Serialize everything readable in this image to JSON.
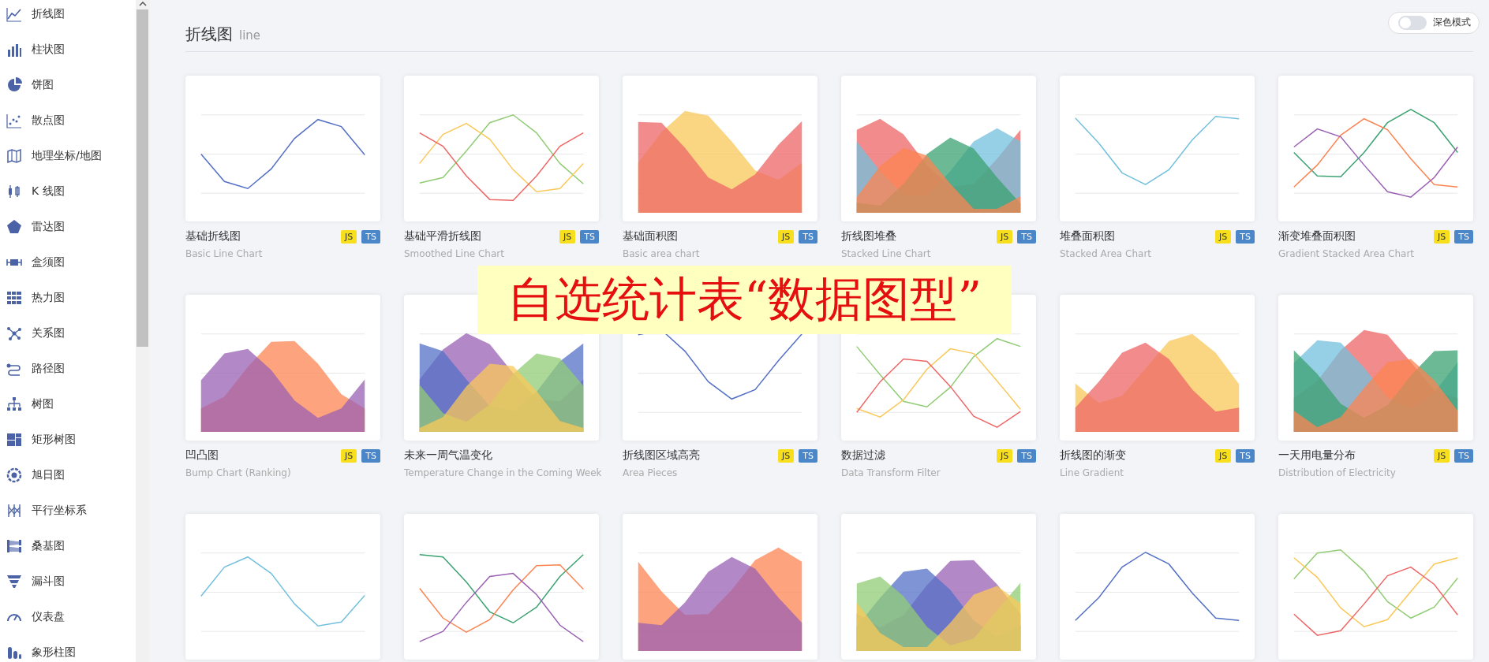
{
  "sidebar": {
    "items": [
      {
        "label": "折线图"
      },
      {
        "label": "柱状图"
      },
      {
        "label": "饼图"
      },
      {
        "label": "散点图"
      },
      {
        "label": "地理坐标/地图"
      },
      {
        "label": "K 线图"
      },
      {
        "label": "雷达图"
      },
      {
        "label": "盒须图"
      },
      {
        "label": "热力图"
      },
      {
        "label": "关系图"
      },
      {
        "label": "路径图"
      },
      {
        "label": "树图"
      },
      {
        "label": "矩形树图"
      },
      {
        "label": "旭日图"
      },
      {
        "label": "平行坐标系"
      },
      {
        "label": "桑基图"
      },
      {
        "label": "漏斗图"
      },
      {
        "label": "仪表盘"
      },
      {
        "label": "象形柱图"
      }
    ]
  },
  "header": {
    "title": "折线图",
    "subtitle": "line"
  },
  "dark_mode": {
    "label": "深色模式",
    "on": false
  },
  "cards": [
    {
      "thumbnail": {
        "kind": "picture"
      },
      "title": "基础折线图",
      "subtitle": "Basic Line Chart",
      "badges": [
        {
          "label": "JS",
          "kind": "js"
        },
        {
          "label": "TS",
          "kind": "ts"
        }
      ]
    },
    {
      "thumbnail": {
        "kind": "picture"
      },
      "title": "基础平滑折线图",
      "subtitle": "Smoothed Line Chart",
      "badges": [
        {
          "label": "JS",
          "kind": "js"
        },
        {
          "label": "TS",
          "kind": "ts"
        }
      ]
    },
    {
      "thumbnail": {
        "kind": "picture"
      },
      "title": "基础面积图",
      "subtitle": "Basic area chart",
      "badges": [
        {
          "label": "JS",
          "kind": "js"
        },
        {
          "label": "TS",
          "kind": "ts"
        }
      ]
    },
    {
      "thumbnail": {
        "kind": "picture"
      },
      "title": "折线图堆叠",
      "subtitle": "Stacked Line Chart",
      "badges": [
        {
          "label": "JS",
          "kind": "js"
        },
        {
          "label": "TS",
          "kind": "ts"
        }
      ]
    },
    {
      "thumbnail": {
        "kind": "picture"
      },
      "title": "堆叠面积图",
      "subtitle": "Stacked Area Chart",
      "badges": [
        {
          "label": "JS",
          "kind": "js"
        },
        {
          "label": "TS",
          "kind": "ts"
        }
      ]
    },
    {
      "thumbnail": {
        "kind": "picture"
      },
      "title": "渐变堆叠面积图",
      "subtitle": "Gradient Stacked Area Chart",
      "badges": [
        {
          "label": "JS",
          "kind": "js"
        },
        {
          "label": "TS",
          "kind": "ts"
        }
      ]
    },
    {
      "thumbnail": {
        "kind": "picture"
      },
      "title": "凹凸图",
      "subtitle": "Bump Chart (Ranking)",
      "badges": [
        {
          "label": "JS",
          "kind": "js"
        },
        {
          "label": "TS",
          "kind": "ts"
        }
      ]
    },
    {
      "thumbnail": {
        "kind": "picture"
      },
      "title": "未来一周气温变化",
      "subtitle": "Temperature Change in the Coming Week"
    },
    {
      "thumbnail": {
        "kind": "picture"
      },
      "title": "折线图区域高亮",
      "subtitle": "Area Pieces",
      "badges": [
        {
          "label": "JS",
          "kind": "js"
        },
        {
          "label": "TS",
          "kind": "ts"
        }
      ]
    },
    {
      "thumbnail": {
        "kind": "picture"
      },
      "title": "数据过滤",
      "subtitle": "Data Transform Filter",
      "badges": [
        {
          "label": "JS",
          "kind": "js"
        },
        {
          "label": "TS",
          "kind": "ts"
        }
      ]
    },
    {
      "thumbnail": {
        "kind": "picture"
      },
      "title": "折线图的渐变",
      "subtitle": "Line Gradient",
      "badges": [
        {
          "label": "JS",
          "kind": "js"
        },
        {
          "label": "TS",
          "kind": "ts"
        }
      ]
    },
    {
      "thumbnail": {
        "kind": "picture"
      },
      "title": "一天用电量分布",
      "subtitle": "Distribution of Electricity",
      "badges": [
        {
          "label": "JS",
          "kind": "js"
        },
        {
          "label": "TS",
          "kind": "ts"
        }
      ]
    },
    {
      "thumbnail": {
        "kind": "picture"
      }
    },
    {
      "thumbnail": {
        "kind": "picture"
      }
    },
    {
      "thumbnail": {
        "kind": "picture"
      }
    },
    {
      "thumbnail": {
        "kind": "picture"
      }
    },
    {
      "thumbnail": {
        "kind": "picture"
      }
    },
    {
      "thumbnail": {
        "kind": "picture"
      }
    }
  ],
  "banner": {
    "text": "自选统计表“数据图型”"
  }
}
